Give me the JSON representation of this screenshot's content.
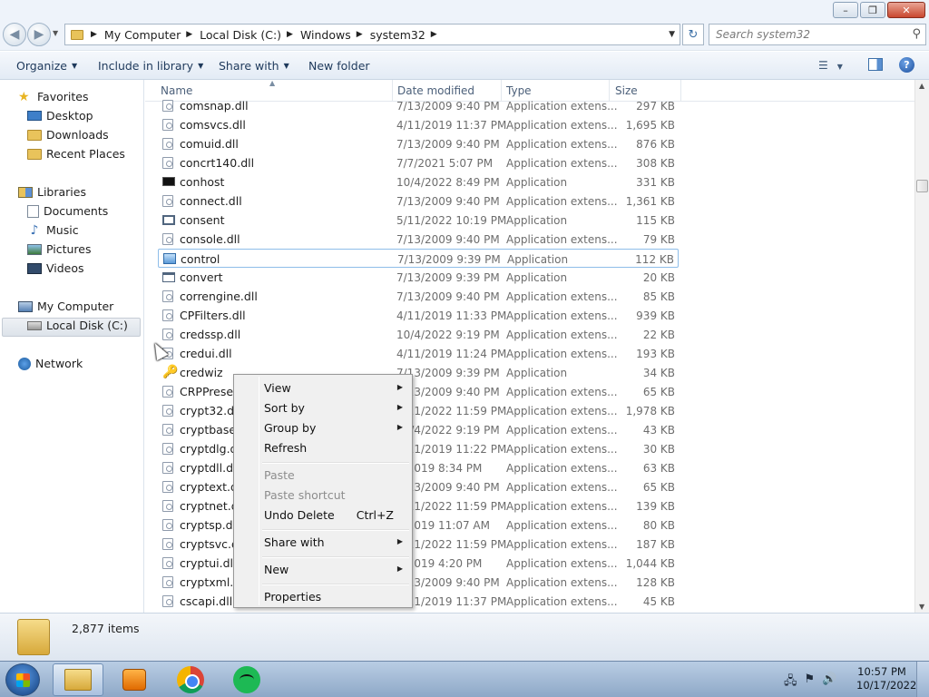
{
  "window": {
    "min_label": "–",
    "max_label": "❐",
    "close_label": "✕"
  },
  "address": {
    "crumbs": [
      "My Computer",
      "Local Disk (C:)",
      "Windows",
      "system32"
    ]
  },
  "search": {
    "placeholder": "Search system32"
  },
  "toolbar": {
    "organize": "Organize",
    "include_in_library": "Include in library",
    "share_with": "Share with",
    "new_folder": "New folder"
  },
  "nav": {
    "favorites": "Favorites",
    "desktop": "Desktop",
    "downloads": "Downloads",
    "recent_places": "Recent Places",
    "libraries": "Libraries",
    "documents": "Documents",
    "music": "Music",
    "pictures": "Pictures",
    "videos": "Videos",
    "my_computer": "My Computer",
    "local_disk": "Local Disk (C:)",
    "network": "Network"
  },
  "columns": {
    "name": "Name",
    "date_modified": "Date modified",
    "type": "Type",
    "size": "Size"
  },
  "files": [
    {
      "name": "comsnap.dll",
      "date": "7/13/2009 9:40 PM",
      "type": "Application extens...",
      "size": "297 KB",
      "icon": "dll"
    },
    {
      "name": "comsvcs.dll",
      "date": "4/11/2019 11:37 PM",
      "type": "Application extens...",
      "size": "1,695 KB",
      "icon": "dll"
    },
    {
      "name": "comuid.dll",
      "date": "7/13/2009 9:40 PM",
      "type": "Application extens...",
      "size": "876 KB",
      "icon": "dll"
    },
    {
      "name": "concrt140.dll",
      "date": "7/7/2021 5:07 PM",
      "type": "Application extens...",
      "size": "308 KB",
      "icon": "dll"
    },
    {
      "name": "conhost",
      "date": "10/4/2022 8:49 PM",
      "type": "Application",
      "size": "331 KB",
      "icon": "console"
    },
    {
      "name": "connect.dll",
      "date": "7/13/2009 9:40 PM",
      "type": "Application extens...",
      "size": "1,361 KB",
      "icon": "dll"
    },
    {
      "name": "consent",
      "date": "5/11/2022 10:19 PM",
      "type": "Application",
      "size": "115 KB",
      "icon": "window"
    },
    {
      "name": "console.dll",
      "date": "7/13/2009 9:40 PM",
      "type": "Application extens...",
      "size": "79 KB",
      "icon": "dll"
    },
    {
      "name": "control",
      "date": "7/13/2009 9:39 PM",
      "type": "Application",
      "size": "112 KB",
      "icon": "control"
    },
    {
      "name": "convert",
      "date": "7/13/2009 9:39 PM",
      "type": "Application",
      "size": "20 KB",
      "icon": "convert"
    },
    {
      "name": "correngine.dll",
      "date": "7/13/2009 9:40 PM",
      "type": "Application extens...",
      "size": "85 KB",
      "icon": "dll"
    },
    {
      "name": "CPFilters.dll",
      "date": "4/11/2019 11:33 PM",
      "type": "Application extens...",
      "size": "939 KB",
      "icon": "dll"
    },
    {
      "name": "credssp.dll",
      "date": "10/4/2022 9:19 PM",
      "type": "Application extens...",
      "size": "22 KB",
      "icon": "dll"
    },
    {
      "name": "credui.dll",
      "date": "4/11/2019 11:24 PM",
      "type": "Application extens...",
      "size": "193 KB",
      "icon": "dll"
    },
    {
      "name": "credwiz",
      "date": "7/13/2009 9:39 PM",
      "type": "Application",
      "size": "34 KB",
      "icon": "key"
    },
    {
      "name": "CRPPresent",
      "date": "7/13/2009 9:40 PM",
      "type": "Application extens...",
      "size": "65 KB",
      "icon": "dll"
    },
    {
      "name": "crypt32.dll",
      "date": "4/11/2022 11:59 PM",
      "type": "Application extens...",
      "size": "1,978 KB",
      "icon": "dll"
    },
    {
      "name": "cryptbase.d",
      "date": "10/4/2022 9:19 PM",
      "type": "Application extens...",
      "size": "43 KB",
      "icon": "dll"
    },
    {
      "name": "cryptdlg.dll",
      "date": "4/11/2019 11:22 PM",
      "type": "Application extens...",
      "size": "30 KB",
      "icon": "dll"
    },
    {
      "name": "cryptdll.dll",
      "date": "3/2019 8:34 PM",
      "type": "Application extens...",
      "size": "63 KB",
      "icon": "dll"
    },
    {
      "name": "cryptext.dll",
      "date": "7/13/2009 9:40 PM",
      "type": "Application extens...",
      "size": "65 KB",
      "icon": "dll"
    },
    {
      "name": "cryptnet.dll",
      "date": "4/11/2022 11:59 PM",
      "type": "Application extens...",
      "size": "139 KB",
      "icon": "dll"
    },
    {
      "name": "cryptsp.dll",
      "date": "2/2019 11:07 AM",
      "type": "Application extens...",
      "size": "80 KB",
      "icon": "dll"
    },
    {
      "name": "cryptsvc.dll",
      "date": "4/11/2022 11:59 PM",
      "type": "Application extens...",
      "size": "187 KB",
      "icon": "dll"
    },
    {
      "name": "cryptui.dll",
      "date": "5/2019 4:20 PM",
      "type": "Application extens...",
      "size": "1,044 KB",
      "icon": "dll"
    },
    {
      "name": "cryptxml.dll",
      "date": "7/13/2009 9:40 PM",
      "type": "Application extens...",
      "size": "128 KB",
      "icon": "dll"
    },
    {
      "name": "cscapi.dll",
      "date": "4/11/2019 11:37 PM",
      "type": "Application extens...",
      "size": "45 KB",
      "icon": "dll"
    }
  ],
  "selected_file": "control",
  "context_menu": {
    "view": "View",
    "sort_by": "Sort by",
    "group_by": "Group by",
    "refresh": "Refresh",
    "paste": "Paste",
    "paste_shortcut": "Paste shortcut",
    "undo_delete": "Undo Delete",
    "undo_shortcut": "Ctrl+Z",
    "share_with": "Share with",
    "new": "New",
    "properties": "Properties"
  },
  "status": {
    "item_count": "2,877 items"
  },
  "clock": {
    "time": "10:57 PM",
    "date": "10/17/2022"
  }
}
